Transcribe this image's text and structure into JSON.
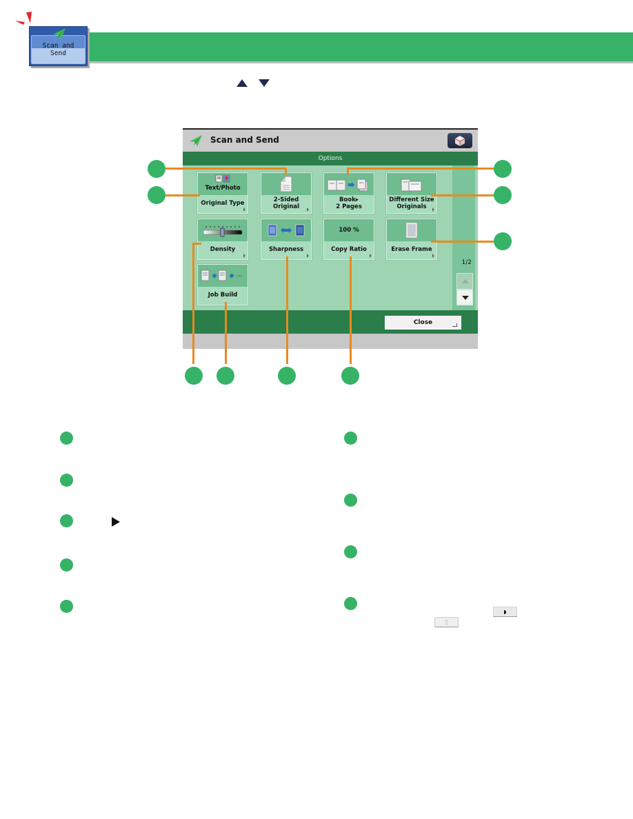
{
  "header": {
    "tile_label": "Scan and\nSend",
    "tile_icon": "paper-plane-icon",
    "nav_icons": [
      "arrow-up-icon",
      "arrow-down-icon"
    ],
    "banner_color": "#36b366"
  },
  "screen": {
    "title": "Scan and Send",
    "title_icon": "paper-plane-icon",
    "settings_icon": "cube-icon",
    "subheader": "Options",
    "buttons": [
      {
        "id": "original-type",
        "top_text": "Text/Photo",
        "label": "Original Type",
        "icon": "text-photo-icon"
      },
      {
        "id": "2-sided-original",
        "top_text": "",
        "label": "2-Sided\nOriginal",
        "icon": "page-icon"
      },
      {
        "id": "book-2-pages",
        "top_text": "",
        "label": "Book▸\n2 Pages",
        "icon": "book-to-pages-icon"
      },
      {
        "id": "different-size-originals",
        "top_text": "",
        "label": "Different Size\nOriginals",
        "icon": "mixed-pages-icon"
      },
      {
        "id": "density",
        "top_text": "",
        "label": "Density",
        "icon": "density-slider-icon"
      },
      {
        "id": "sharpness",
        "top_text": "",
        "label": "Sharpness",
        "icon": "sharpness-icon"
      },
      {
        "id": "copy-ratio",
        "top_text": "100 %",
        "label": "Copy Ratio",
        "icon": ""
      },
      {
        "id": "erase-frame",
        "top_text": "",
        "label": "Erase Frame",
        "icon": "frame-page-icon"
      },
      {
        "id": "job-build",
        "top_text": "",
        "label": "Job Build",
        "icon": "job-build-icon"
      }
    ],
    "pager": "1/2",
    "close_label": "Close"
  },
  "callout_color": "#e88a1e",
  "legend": {
    "left_items": 5,
    "right_items": 4,
    "inline_glyph": "play-triangle-icon"
  }
}
